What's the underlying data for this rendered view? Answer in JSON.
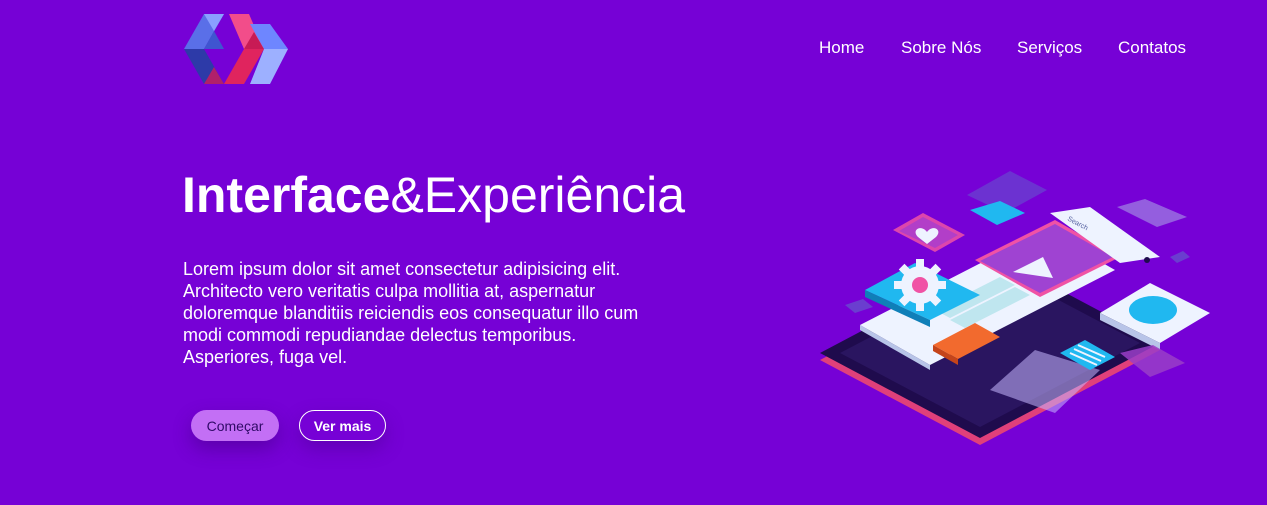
{
  "brand": {
    "logo_icon": "polymer-logo-icon"
  },
  "nav": {
    "items": [
      {
        "label": "Home"
      },
      {
        "label": "Sobre Nós"
      },
      {
        "label": "Serviços"
      },
      {
        "label": "Contatos"
      }
    ]
  },
  "hero": {
    "title_bold": "Interface",
    "title_rest": "&Experiência",
    "description": "Lorem ipsum dolor sit amet consectetur adipisicing elit. Architecto vero veritatis culpa mollitia at, aspernatur doloremque blanditiis reiciendis eos consequatur illo cum modi commodi repudiandae delectus temporibus. Asperiores, fuga vel.",
    "primary_button": "Começar",
    "secondary_button": "Ver mais"
  },
  "illustration": {
    "search_label": "Search"
  },
  "colors": {
    "background": "#7601d6",
    "primary_button": "#c36ff5"
  }
}
